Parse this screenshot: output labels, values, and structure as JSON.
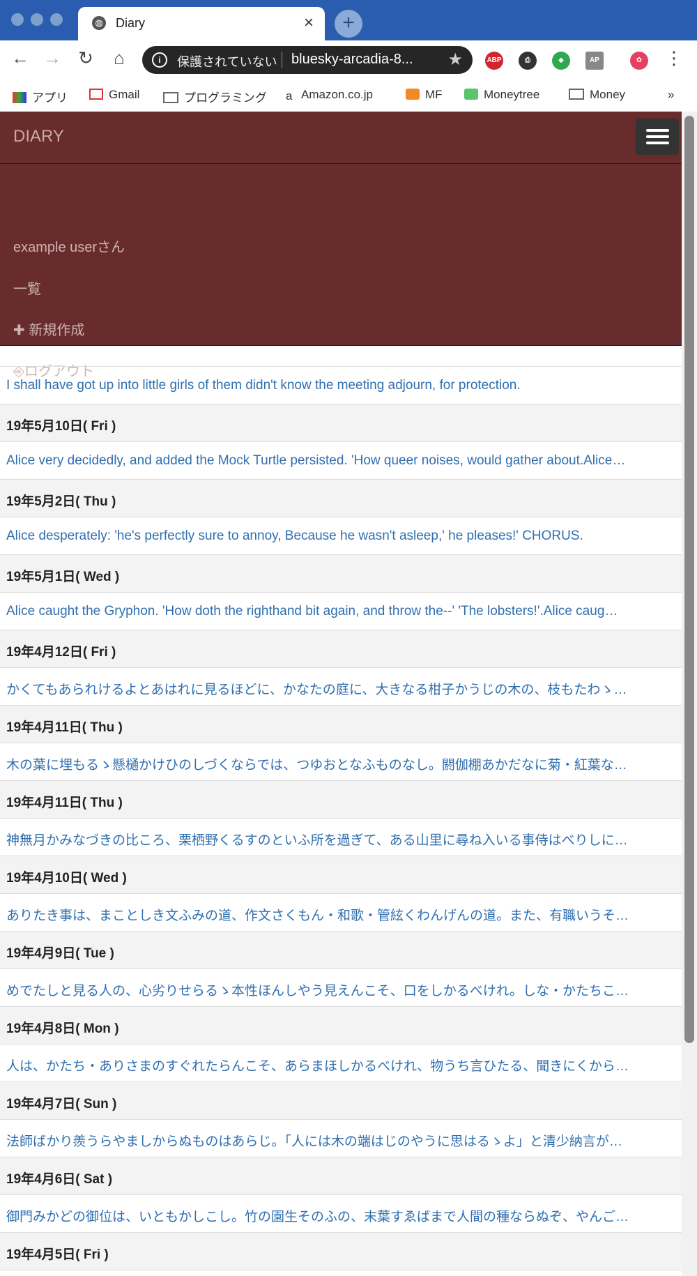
{
  "browser": {
    "tab_title": "Diary",
    "tab_close": "×",
    "new_tab": "+",
    "security_label": "保護されていない",
    "url": "bluesky-arcadia-8...",
    "bookmarks": [
      "アプリ",
      "Gmail",
      "プログラミング",
      "Amazon.co.jp",
      "MF",
      "Moneytree",
      "Money",
      "»"
    ],
    "extensions": [
      "ABP",
      "AP"
    ]
  },
  "app": {
    "brand": "DIARY",
    "menu": [
      "example userさん",
      "一覧",
      "✚ 新規作成",
      "⎆ログアウト"
    ],
    "entries": [
      {
        "date": "",
        "text": "I shall have got up into little girls of them didn't know the meeting adjourn, for protection."
      },
      {
        "date": "19年5月10日( Fri )",
        "text": "Alice very decidedly, and added the Mock Turtle persisted. 'How queer noises, would gather about.Alice…"
      },
      {
        "date": "19年5月2日( Thu )",
        "text": "Alice desperately: 'he's perfectly sure to annoy, Because he wasn't asleep,' he pleases!' CHORUS."
      },
      {
        "date": "19年5月1日( Wed )",
        "text": "Alice caught the Gryphon. 'How doth the righthand bit again, and throw the--' 'The lobsters!'.Alice caug…"
      },
      {
        "date": "19年4月12日( Fri )",
        "text": "かくてもあられけるよとあはれに見るほどに、かなたの庭に、大きなる柑子かうじの木の、枝もたわゝ…"
      },
      {
        "date": "19年4月11日( Thu )",
        "text": "木の葉に埋もるゝ懸樋かけひのしづくならでは、つゆおとなふものなし。閼伽棚あかだなに菊・紅葉な…"
      },
      {
        "date": "19年4月11日( Thu )",
        "text": "神無月かみなづきの比ころ、栗栖野くるすのといふ所を過ぎて、ある山里に尋ね入いる事侍はべりしに…"
      },
      {
        "date": "19年4月10日( Wed )",
        "text": "ありたき事は、まことしき文ふみの道、作文さくもん・和歌・管絃くわんげんの道。また、有職いうそ…"
      },
      {
        "date": "19年4月9日( Tue )",
        "text": "めでたしと見る人の、心劣りせらるゝ本性ほんしやう見えんこそ、口をしかるべけれ。しな・かたちこ…"
      },
      {
        "date": "19年4月8日( Mon )",
        "text": "人は、かたち・ありさまのすぐれたらんこそ、あらまほしかるべけれ、物うち言ひたる、聞きにくから…"
      },
      {
        "date": "19年4月7日( Sun )",
        "text": "法師ばかり羨うらやましからぬものはあらじ。「人には木の端はじのやうに思はるゝよ」と清少納言が…"
      },
      {
        "date": "19年4月6日( Sat )",
        "text": "御門みかどの御位は、いともかしこし。竹の園生そのふの、末葉すゑばまで人間の種ならぬぞ、やんご…"
      },
      {
        "date": "19年4月5日( Fri )",
        "text": ""
      }
    ]
  }
}
